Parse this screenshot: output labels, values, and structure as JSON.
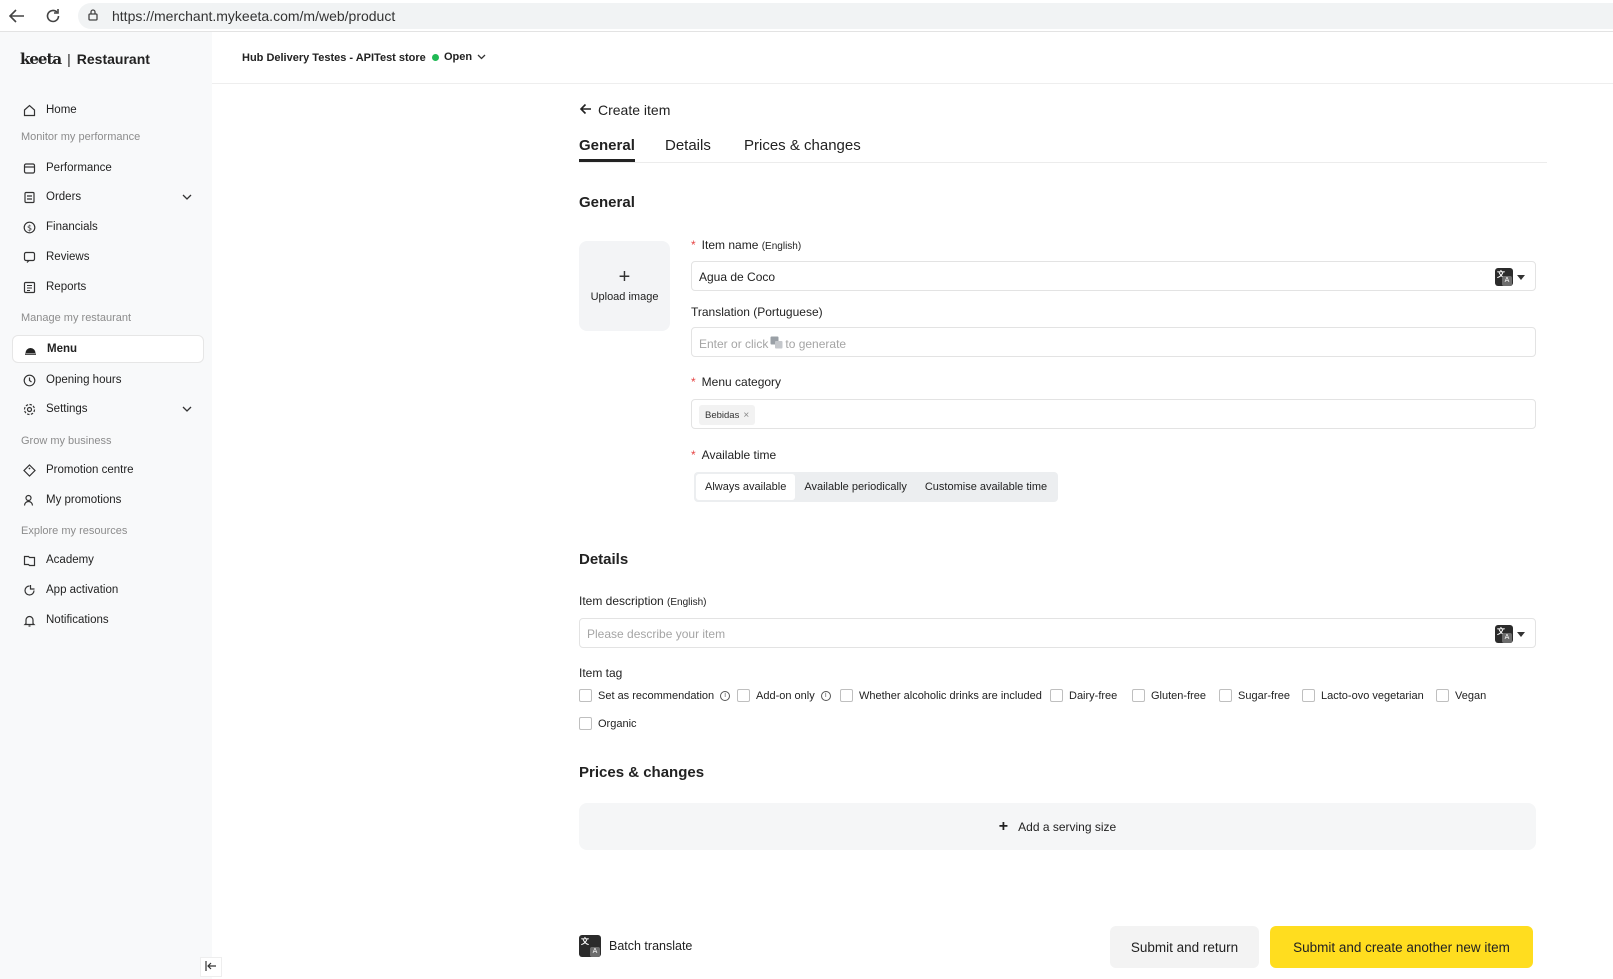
{
  "browser": {
    "url": "https://merchant.mykeeta.com/m/web/product"
  },
  "sidebar": {
    "logo_mark": "keeta",
    "logo_text": "Restaurant",
    "sections": {
      "monitor": "Monitor my performance",
      "manage": "Manage my restaurant",
      "grow": "Grow my business",
      "explore": "Explore my resources"
    },
    "items": {
      "home": "Home",
      "performance": "Performance",
      "orders": "Orders",
      "financials": "Financials",
      "reviews": "Reviews",
      "reports": "Reports",
      "menu": "Menu",
      "opening_hours": "Opening hours",
      "settings": "Settings",
      "promotion_centre": "Promotion centre",
      "my_promotions": "My promotions",
      "academy": "Academy",
      "app_activation": "App activation",
      "notifications": "Notifications"
    },
    "active_item": "menu"
  },
  "header": {
    "store_name": "Hub Delivery Testes - APITest store",
    "status": "Open",
    "status_color": "#1fb954"
  },
  "main": {
    "back_label": "Create item",
    "tabs": [
      "General",
      "Details",
      "Prices & changes"
    ],
    "active_tab": "General",
    "general": {
      "title": "General",
      "upload_label": "Upload image",
      "item_name_label": "Item name",
      "item_name_lang": "(English)",
      "item_name_value": "Agua de Coco",
      "translation_label": "Translation (Portuguese)",
      "translation_placeholder_pre": "Enter or click",
      "translation_placeholder_post": "to generate",
      "menu_category_label": "Menu category",
      "menu_category_chip": "Bebidas",
      "available_time_label": "Available time",
      "available_time_options": [
        "Always available",
        "Available periodically",
        "Customise available time"
      ],
      "available_time_selected": "Always available"
    },
    "details": {
      "title": "Details",
      "description_label": "Item description",
      "description_lang": "(English)",
      "description_placeholder": "Please describe your item",
      "item_tag_label": "Item tag",
      "tags": [
        "Set as recommendation",
        "Add-on only",
        "Whether alcoholic drinks are included",
        "Dairy-free",
        "Gluten-free",
        "Sugar-free",
        "Lacto-ovo vegetarian",
        "Vegan",
        "Organic"
      ]
    },
    "prices": {
      "title": "Prices & changes",
      "add_serving_label": "Add a serving size"
    },
    "footer": {
      "batch_translate": "Batch translate",
      "submit_return": "Submit and return",
      "submit_new": "Submit and create another new item",
      "primary_color": "#ffdd1f"
    }
  }
}
